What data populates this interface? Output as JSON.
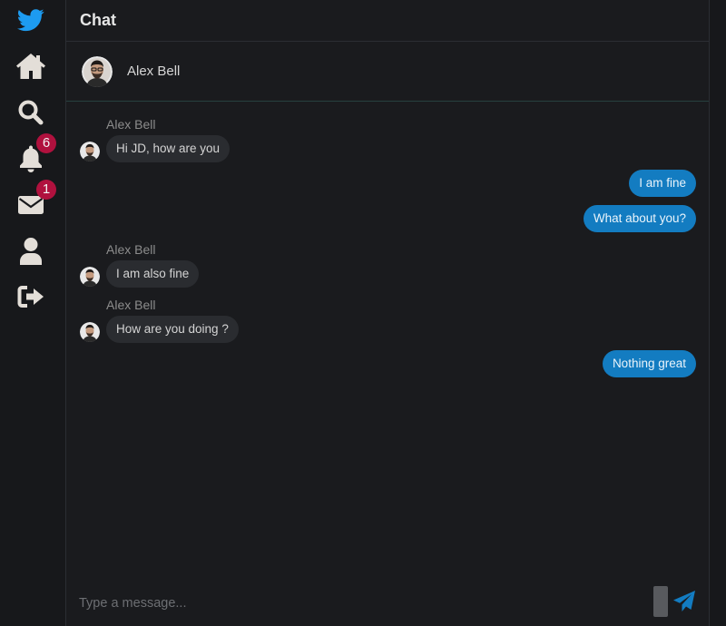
{
  "sidebar": {
    "items": [
      {
        "icon": "twitter-bird-icon",
        "color": "#1d9bf0"
      },
      {
        "icon": "home-icon"
      },
      {
        "icon": "search-icon"
      },
      {
        "icon": "bell-icon",
        "badge": "6"
      },
      {
        "icon": "envelope-icon",
        "badge": "1"
      },
      {
        "icon": "user-icon"
      },
      {
        "icon": "logout-icon"
      }
    ]
  },
  "page": {
    "title": "Chat"
  },
  "chat": {
    "contact_name": "Alex Bell",
    "messages": [
      {
        "direction": "incoming",
        "sender": "Alex Bell",
        "text": "Hi JD, how are you"
      },
      {
        "direction": "outgoing",
        "text": "I am fine"
      },
      {
        "direction": "outgoing",
        "text": "What about you?"
      },
      {
        "direction": "incoming",
        "sender": "Alex Bell",
        "text": "I am also fine"
      },
      {
        "direction": "incoming",
        "sender": "Alex Bell",
        "text": "How are you doing ?"
      },
      {
        "direction": "outgoing",
        "text": "Nothing great"
      }
    ]
  },
  "composer": {
    "placeholder": "Type a message...",
    "send_icon": "paper-plane-icon"
  },
  "colors": {
    "accent": "#137cc1",
    "badge": "#b0113e",
    "background": "#1a1b1e",
    "icon": "#e3ded8"
  }
}
